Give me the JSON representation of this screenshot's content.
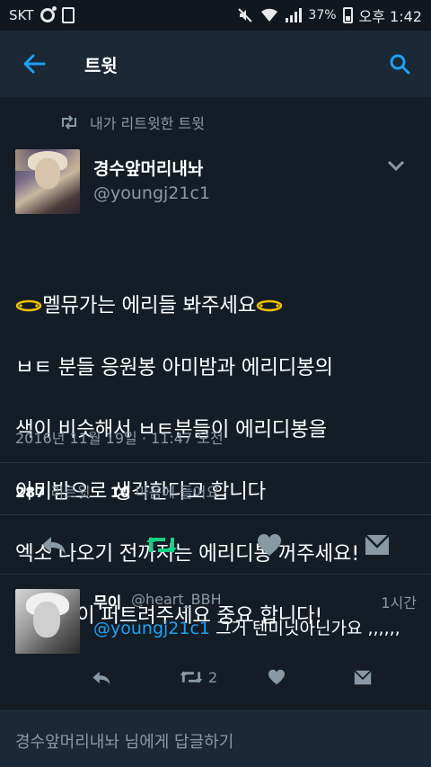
{
  "status_bar": {
    "carrier": "SKT",
    "battery": "37%",
    "time": "오후 1:42"
  },
  "header": {
    "title": "트윗"
  },
  "tweet": {
    "retweet_context": "내가 리트윗한 트윗",
    "display_name": "경수앞머리내놔",
    "handle": "@youngj21c1",
    "text_lines": [
      "멜뮤가는 에리들 봐주세요",
      "ㅂㅌ 분들 응원봉 아미밤과 에리디봉의",
      "색이 비슷해서 ㅂㅌ분들이 에리디봉을",
      "아미밤으로 생각한다고 합니다",
      "엑소 나오기 전까지는 에리디봉 꺼주세요!",
      "많이 많이 퍼트려주세요 중요 합니다!"
    ],
    "timestamp": "2016년 11월 19일 · 11:47 오전",
    "retweet_count": "287",
    "retweet_label": "리트윗",
    "like_count": "10",
    "like_label": "마음에 들어요"
  },
  "reply": {
    "display_name": "무이",
    "handle": "@heart_BBH",
    "time": "1시간",
    "mention": "@youngj21c1",
    "text": "그거 텐미닛아닌가요 ,,,,,,",
    "retweet_count": "2"
  },
  "reply_box": {
    "placeholder": "경수앞머리내놔 님에게 답글하기"
  },
  "colors": {
    "background": "#141d26",
    "header": "#1b2836",
    "accent": "#1da1f2",
    "retweet_green": "#19cf86",
    "muted": "#8899a6"
  }
}
